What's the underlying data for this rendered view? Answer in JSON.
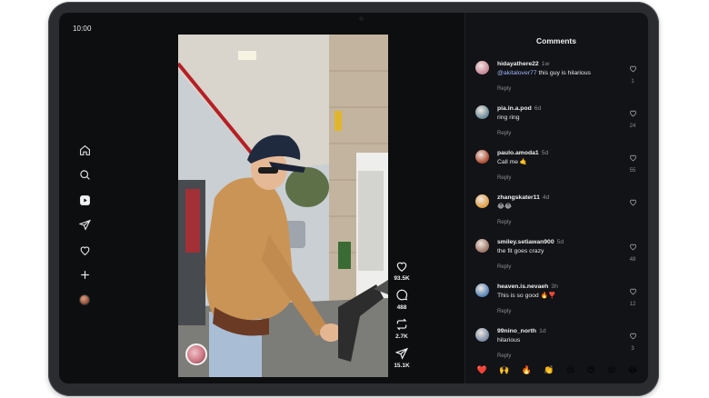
{
  "status_bar": {
    "time": "10:00"
  },
  "nav": {
    "items": [
      {
        "name": "home",
        "icon": "home-icon"
      },
      {
        "name": "search",
        "icon": "search-icon"
      },
      {
        "name": "reels",
        "icon": "reels-icon"
      },
      {
        "name": "direct",
        "icon": "send-icon"
      },
      {
        "name": "activity",
        "icon": "heart-icon"
      },
      {
        "name": "create",
        "icon": "plus-icon"
      },
      {
        "name": "profile",
        "icon": "avatar"
      }
    ]
  },
  "video_actions": {
    "likes": "93.5K",
    "comments": "488",
    "reposts": "2.7K",
    "shares": "15.1K"
  },
  "comments_panel": {
    "title": "Comments",
    "reply_label": "Reply",
    "items": [
      {
        "username": "hidayathere22",
        "time": "1w",
        "mention": "@akitalover77",
        "text": " this guy is hilarious",
        "likes": "1",
        "avatar_color": "#c98a9a"
      },
      {
        "username": "pia.in.a.pod",
        "time": "6d",
        "mention": "",
        "text": "ring ring",
        "likes": "24",
        "avatar_color": "#6f8f9c"
      },
      {
        "username": "paulo.amoda1",
        "time": "5d",
        "mention": "",
        "text": "Call me 🤙",
        "likes": "55",
        "avatar_color": "#b0523a"
      },
      {
        "username": "zhangskater11",
        "time": "4d",
        "mention": "",
        "text": "😂😂",
        "likes": "",
        "avatar_color": "#e0a24a"
      },
      {
        "username": "smiley.setiawan900",
        "time": "5d",
        "mention": "",
        "text": "the fit goes crazy",
        "likes": "48",
        "avatar_color": "#a07a6a"
      },
      {
        "username": "heaven.is.nevaeh",
        "time": "3h",
        "mention": "",
        "text": "This is so good 🔥❣️",
        "likes": "12",
        "avatar_color": "#5a88b8"
      },
      {
        "username": "99nino_north",
        "time": "1d",
        "mention": "",
        "text": "hilarious",
        "likes": "3",
        "avatar_color": "#7d8fa8"
      }
    ],
    "emoji_bar": [
      "❤️",
      "🙌",
      "🔥",
      "👏",
      "😢",
      "😍",
      "😮",
      "😂"
    ]
  }
}
